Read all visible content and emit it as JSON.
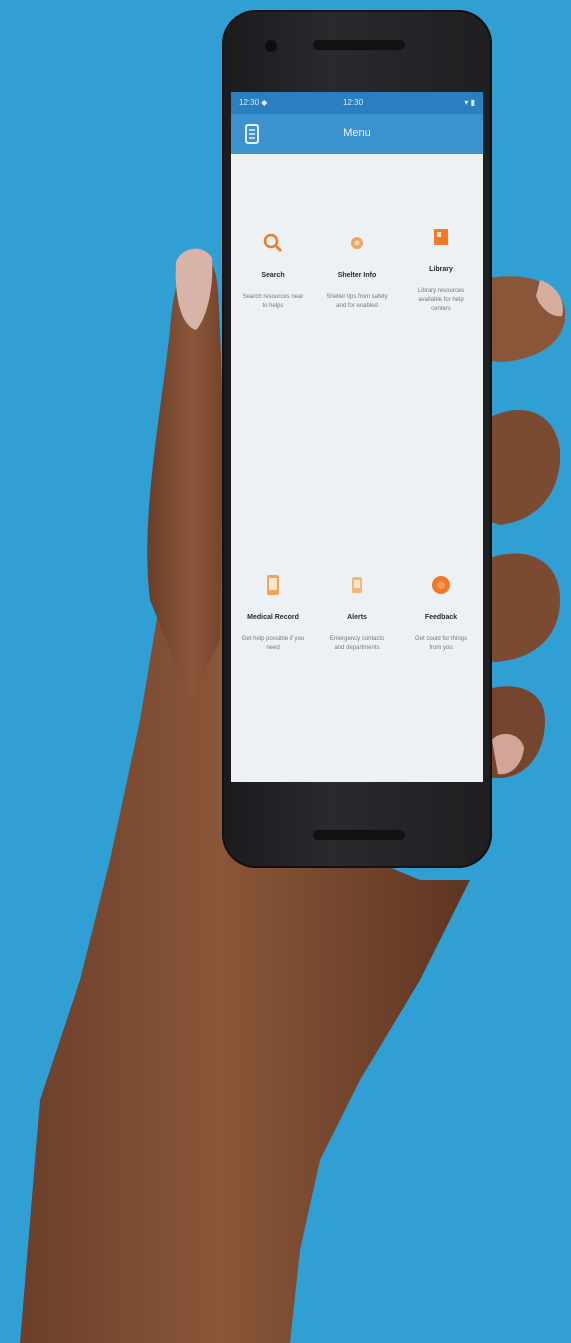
{
  "app": {
    "status": {
      "left": "12:30 ◆",
      "center": "12:30",
      "right": "▾ ▮"
    },
    "appbar": {
      "title": "Menu"
    },
    "tiles": [
      {
        "title": "Search",
        "description": "Search resources near to helps",
        "icon": "search-icon"
      },
      {
        "title": "Shelter Info",
        "description": "Shelter tips from safety and for enabled",
        "icon": "shelter-icon"
      },
      {
        "title": "Library",
        "description": "Library resources available for help centers",
        "icon": "library-icon"
      },
      {
        "title": "Medical Record",
        "description": "Get help possible if you need",
        "icon": "medical-record-icon"
      },
      {
        "title": "Alerts",
        "description": "Emergency contacts and departments",
        "icon": "alerts-icon"
      },
      {
        "title": "Feedback",
        "description": "Get could for things from you",
        "icon": "feedback-icon"
      }
    ],
    "colors": {
      "background": "#2f9fd4",
      "appbar": "#3b92d1",
      "accent": "#f07a2a"
    }
  }
}
